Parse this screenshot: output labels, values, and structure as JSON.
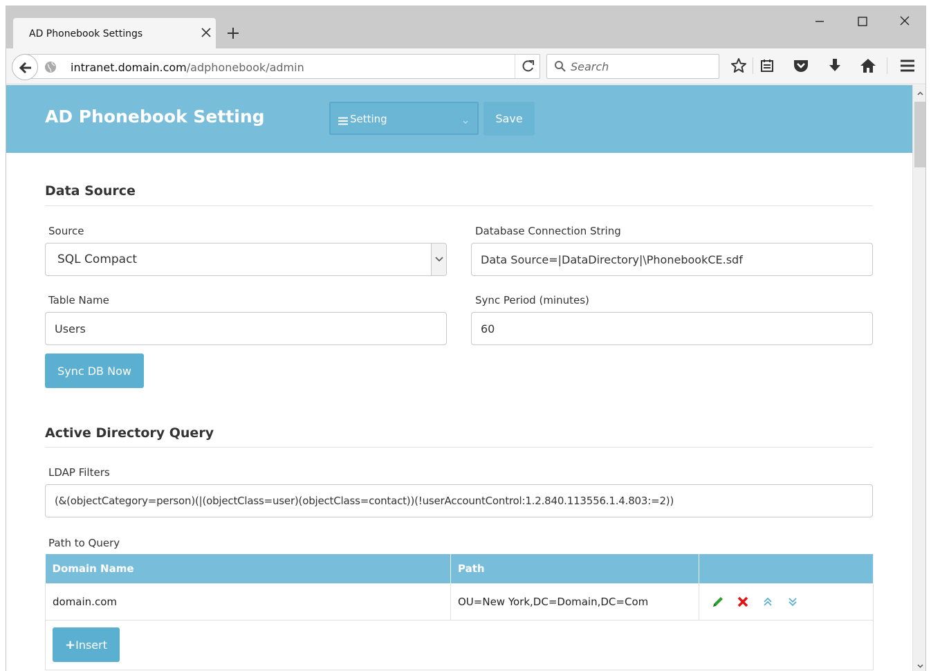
{
  "browser": {
    "tab_title": "AD Phonebook Settings",
    "url_host": "intranet.domain.com",
    "url_path": "/adphonebook/admin",
    "search_placeholder": "Search"
  },
  "header": {
    "title": "AD Phonebook Setting",
    "menu_label": "Setting",
    "save_label": "Save"
  },
  "data_source": {
    "section_title": "Data Source",
    "source_label": "Source",
    "source_value": "SQL Compact",
    "conn_label": "Database Connection String",
    "conn_value": "Data Source=|DataDirectory|\\PhonebookCE.sdf",
    "table_label": "Table Name",
    "table_value": "Users",
    "sync_label": "Sync Period (minutes)",
    "sync_value": "60",
    "sync_button": "Sync DB Now"
  },
  "ad_query": {
    "section_title": "Active Directory Query",
    "ldap_label": "LDAP Filters",
    "ldap_value": "(&(objectCategory=person)(|(objectClass=user)(objectClass=contact))(!userAccountControl:1.2.840.113556.1.4.803:=2))",
    "path_label": "Path to Query",
    "columns": [
      "Domain Name",
      "Path",
      ""
    ],
    "rows": [
      {
        "domain": "domain.com",
        "path": "OU=New York,DC=Domain,DC=Com"
      }
    ],
    "insert_label": "Insert"
  },
  "colors": {
    "header_bg": "#78bedb",
    "button_bg": "#5bb0d2",
    "edit_icon": "#2e9e2e",
    "delete_icon": "#e31414",
    "move_icon": "#5bb0d2"
  },
  "icons": [
    "back-arrow-icon",
    "globe-icon",
    "reload-icon",
    "search-icon",
    "bookmark-star-icon",
    "reading-list-icon",
    "pocket-icon",
    "download-icon",
    "home-icon",
    "menu-icon",
    "pencil-icon",
    "delete-icon",
    "move-up-icon",
    "move-down-icon"
  ]
}
